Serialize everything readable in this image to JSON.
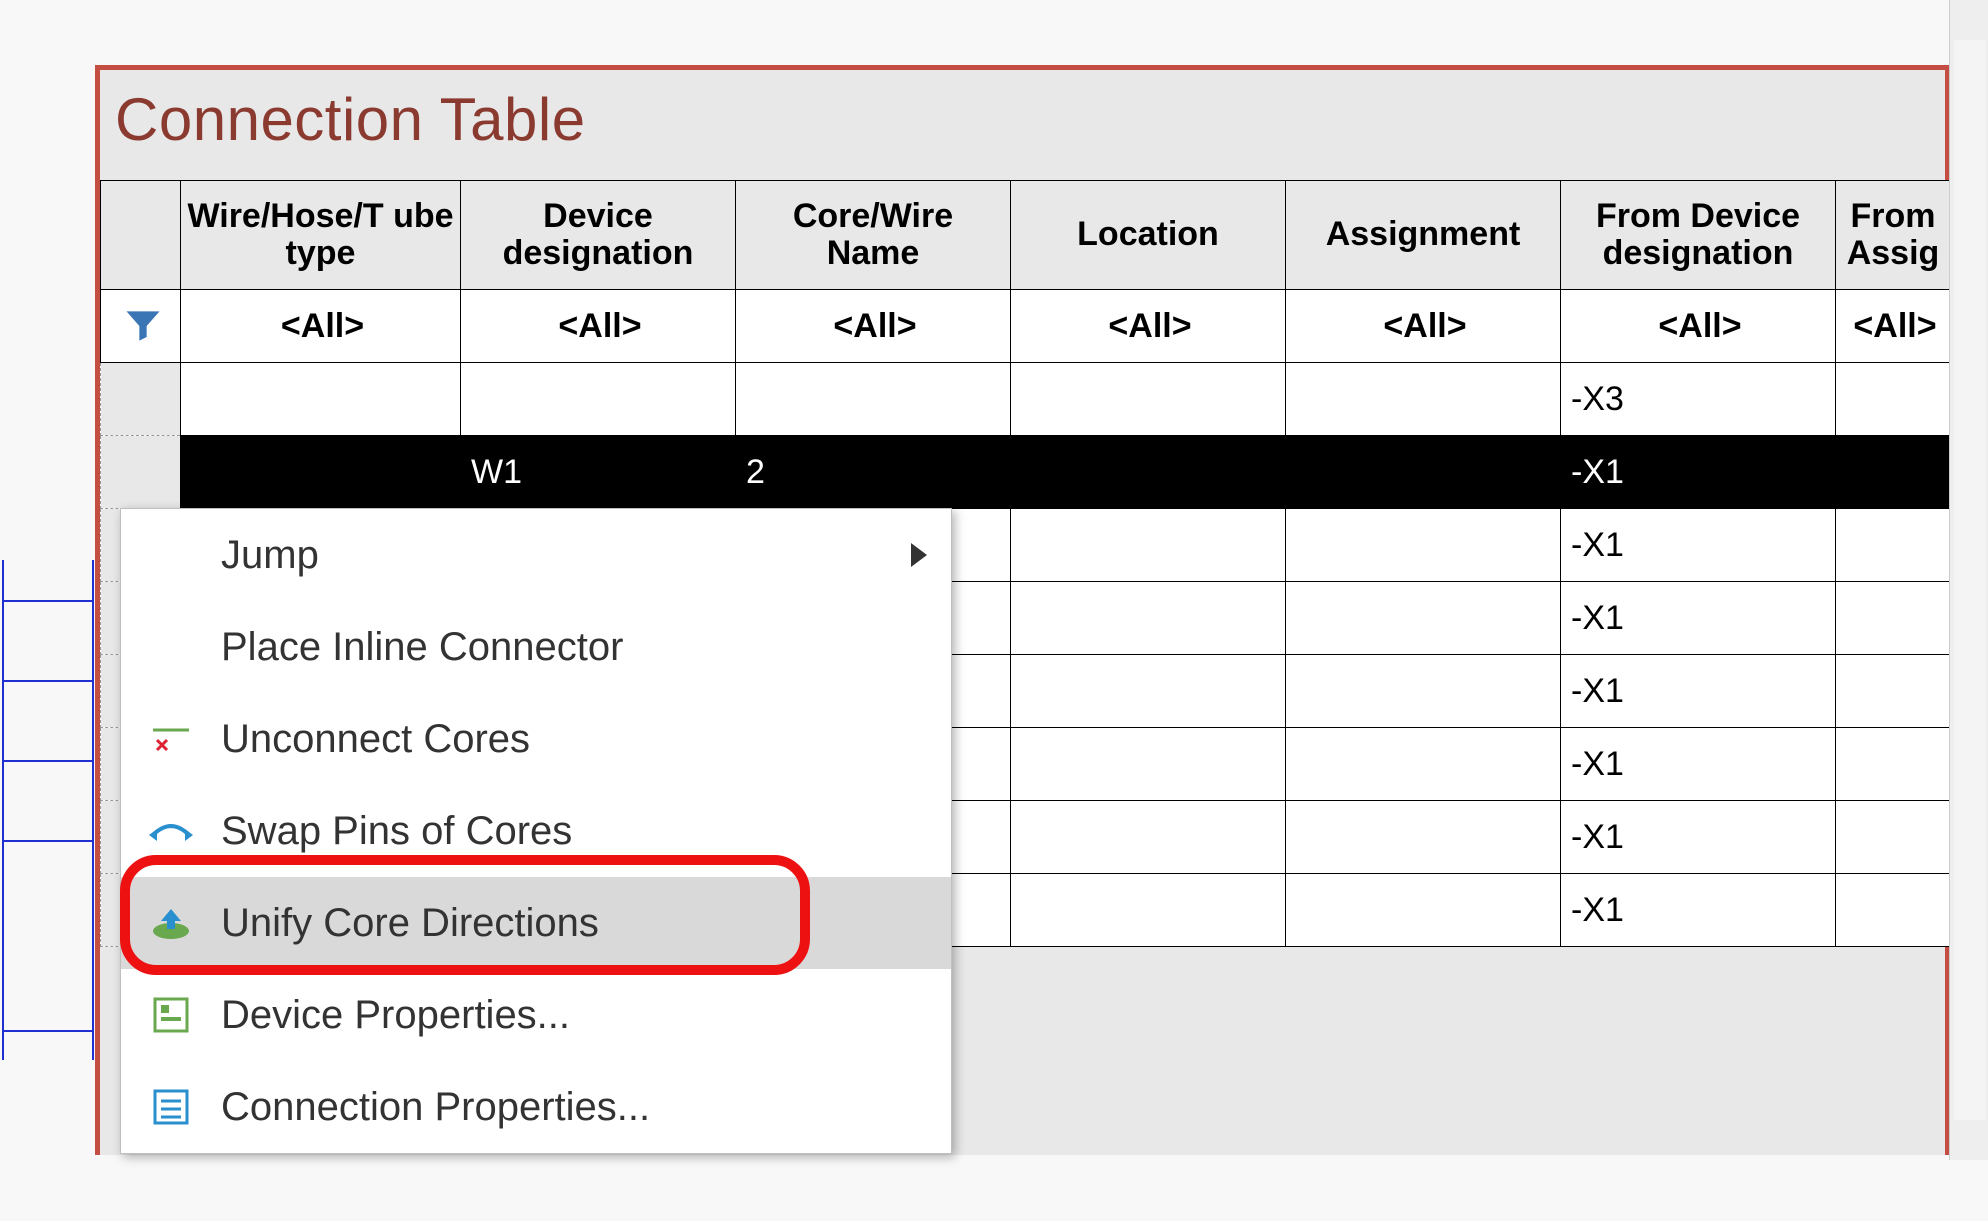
{
  "title": "Connection Table",
  "filter_label": "<All>",
  "columns": [
    {
      "key": "rownum",
      "label": ""
    },
    {
      "key": "wiretype",
      "label": "Wire/Hose/T ube type"
    },
    {
      "key": "devdes",
      "label": "Device designation"
    },
    {
      "key": "corename",
      "label": "Core/Wire Name"
    },
    {
      "key": "location",
      "label": "Location"
    },
    {
      "key": "assign",
      "label": "Assignment"
    },
    {
      "key": "fromdev",
      "label": "From Device designation"
    },
    {
      "key": "fromassign",
      "label": "From Assig"
    }
  ],
  "rows": [
    {
      "wiretype": "",
      "devdes": "",
      "corename": "",
      "location": "",
      "assign": "",
      "fromdev": "-X3",
      "fromassign": ""
    },
    {
      "wiretype": "",
      "devdes": "W1",
      "corename": "2",
      "location": "",
      "assign": "",
      "fromdev": "-X1",
      "fromassign": "",
      "selected": true
    },
    {
      "wiretype": "",
      "devdes": "",
      "corename": "",
      "location": "",
      "assign": "",
      "fromdev": "-X1",
      "fromassign": ""
    },
    {
      "wiretype": "",
      "devdes": "",
      "corename": "",
      "location": "",
      "assign": "",
      "fromdev": "-X1",
      "fromassign": ""
    },
    {
      "wiretype": "",
      "devdes": "",
      "corename": "",
      "location": "",
      "assign": "",
      "fromdev": "-X1",
      "fromassign": ""
    },
    {
      "wiretype": "",
      "devdes": "",
      "corename": "",
      "location": "",
      "assign": "",
      "fromdev": "-X1",
      "fromassign": ""
    },
    {
      "wiretype": "",
      "devdes": "",
      "corename": "",
      "location": "",
      "assign": "",
      "fromdev": "-X1",
      "fromassign": ""
    },
    {
      "wiretype": "",
      "devdes": "",
      "corename": "",
      "location": "",
      "assign": "",
      "fromdev": "-X1",
      "fromassign": ""
    }
  ],
  "context_menu": {
    "items": [
      {
        "icon": "",
        "label": "Jump",
        "submenu": true
      },
      {
        "icon": "",
        "label": "Place Inline Connector"
      },
      {
        "icon": "unconnect",
        "label": "Unconnect Cores"
      },
      {
        "icon": "swap",
        "label": "Swap Pins of Cores"
      },
      {
        "icon": "unify",
        "label": "Unify Core Directions",
        "hover": true
      },
      {
        "icon": "devprop",
        "label": "Device Properties..."
      },
      {
        "icon": "connprop",
        "label": "Connection Properties..."
      }
    ]
  },
  "highlighted_menu_index": 4
}
